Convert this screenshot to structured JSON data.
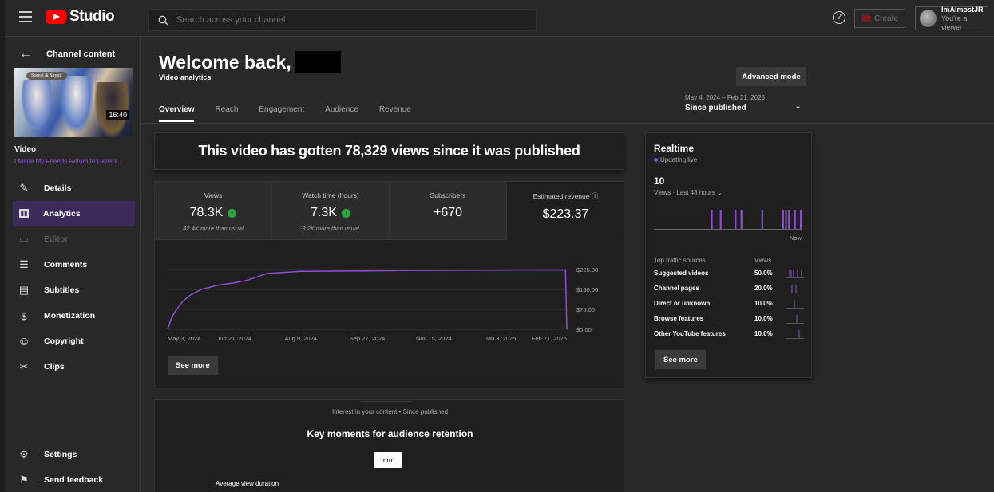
{
  "app": {
    "name": "Studio",
    "search_placeholder": "Search across your channel",
    "create_label": "Create",
    "account_name": "ImAlmostJR",
    "account_role": "You're a viewer"
  },
  "sidebar": {
    "back_label": "Channel content",
    "video_duration": "16:40",
    "thumb_tag": "Sorval & Saypil",
    "video_heading": "Video",
    "video_title": "I Made My Friends Return to Genshi...",
    "items": [
      {
        "label": "Details",
        "icon": "pencil-icon"
      },
      {
        "label": "Analytics",
        "icon": "analytics-icon"
      },
      {
        "label": "Editor",
        "icon": "editor-icon"
      },
      {
        "label": "Comments",
        "icon": "comments-icon"
      },
      {
        "label": "Subtitles",
        "icon": "subtitles-icon"
      },
      {
        "label": "Monetization",
        "icon": "dollar-icon"
      },
      {
        "label": "Copyright",
        "icon": "copyright-icon"
      },
      {
        "label": "Clips",
        "icon": "scissors-icon"
      }
    ],
    "bottom": [
      {
        "label": "Settings",
        "icon": "gear-icon"
      },
      {
        "label": "Send feedback",
        "icon": "feedback-icon"
      }
    ]
  },
  "header": {
    "welcome": "Welcome back,",
    "subtitle": "Video analytics",
    "tabs": [
      "Overview",
      "Reach",
      "Engagement",
      "Audience",
      "Revenue"
    ],
    "advanced_mode": "Advanced mode",
    "date_range": "May 4, 2024 – Feb 21, 2025",
    "date_label": "Since published"
  },
  "banner": "This video has gotten 78,329 views since it was published",
  "metrics": [
    {
      "label": "Views",
      "value": "78.3K",
      "note": "42.4K more than usual",
      "up": true
    },
    {
      "label": "Watch time (hours)",
      "value": "7.3K",
      "note": "3.2K more than usual",
      "up": true
    },
    {
      "label": "Subscribers",
      "value": "+670",
      "note": "",
      "up": false
    },
    {
      "label": "Estimated revenue",
      "value": "$223.37",
      "note": "",
      "up": false
    }
  ],
  "chart_data": {
    "type": "line",
    "title": "",
    "xlabel": "",
    "ylabel": "",
    "x_ticks": [
      "May 3, 2024",
      "Jun 21, 2024",
      "Aug 9, 2024",
      "Sep 27, 2024",
      "Nov 15, 2024",
      "Jan 3, 2025",
      "Feb 21, 2025"
    ],
    "y_ticks": [
      "$0.00",
      "$75.00",
      "$150.00",
      "$225.00"
    ],
    "ylim": [
      0,
      225
    ],
    "y_axis_position": "right",
    "series": [
      {
        "x": [
          "2024-05-03",
          "2024-05-06",
          "2024-05-09",
          "2024-05-14",
          "2024-05-20",
          "2024-05-28",
          "2024-06-08",
          "2024-06-21",
          "2024-07-01",
          "2024-07-15",
          "2024-08-09",
          "2024-09-27",
          "2024-11-15",
          "2025-01-03",
          "2025-02-20",
          "2025-02-21"
        ],
        "values": [
          0,
          45,
          70,
          105,
          130,
          150,
          165,
          175,
          185,
          210,
          218,
          220,
          222,
          223,
          223.37,
          0
        ]
      }
    ],
    "line_color": "#8f4cd9",
    "grid": true
  },
  "see_more": "See more",
  "retention": {
    "subtitle": "Interest in your content • Since published",
    "title": "Key moments for audience retention",
    "intro_label": "Intro",
    "avg_label": "Average view duration"
  },
  "realtime": {
    "title": "Realtime",
    "live_label": "Updating live",
    "count": "10",
    "caption": "Views · Last 48 hours",
    "now_label": "Now",
    "bars": [
      0,
      0,
      0,
      0,
      0,
      0,
      0,
      0,
      0,
      0,
      0,
      0,
      0,
      0,
      0,
      0,
      0,
      0,
      0,
      1,
      0,
      0,
      1,
      0,
      0,
      0,
      0,
      1,
      0,
      1,
      0,
      0,
      0,
      0,
      0,
      0,
      1,
      0,
      0,
      0,
      0,
      0,
      0,
      1,
      1,
      1,
      0,
      1,
      0,
      1
    ],
    "table_head": [
      "Top traffic sources",
      "Views"
    ],
    "sources": [
      {
        "name": "Suggested videos",
        "pct": "50.0%"
      },
      {
        "name": "Channel pages",
        "pct": "20.0%"
      },
      {
        "name": "Direct or unknown",
        "pct": "10.0%"
      },
      {
        "name": "Browse features",
        "pct": "10.0%"
      },
      {
        "name": "Other YouTube features",
        "pct": "10.0%"
      }
    ],
    "see_more": "See more"
  }
}
